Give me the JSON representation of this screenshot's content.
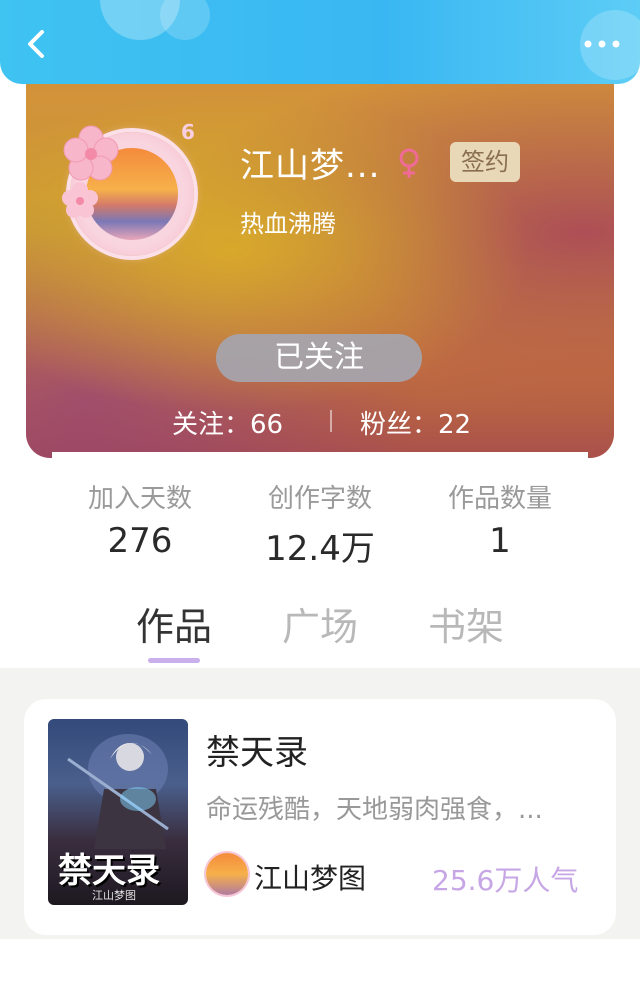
{
  "header": {
    "back_icon": "chevron-left-icon",
    "more_icon": "more-dots-icon"
  },
  "profile": {
    "username": "江山梦...",
    "gender_icon": "female-icon",
    "sign_badge": "签约",
    "tagline": "热血沸腾",
    "level": "6",
    "follow_button": "已关注",
    "following_text": "关注：66",
    "fans_text": "粉丝：22"
  },
  "stats": [
    {
      "label": "加入天数",
      "value": "276"
    },
    {
      "label": "创作字数",
      "value": "12.4万"
    },
    {
      "label": "作品数量",
      "value": "1"
    }
  ],
  "tabs": [
    {
      "label": "作品",
      "active": true
    },
    {
      "label": "广场",
      "active": false
    },
    {
      "label": "书架",
      "active": false
    }
  ],
  "book": {
    "title": "禁天录",
    "description": "命运残酷，天地弱肉强食，...",
    "author": "江山梦图",
    "popularity": "25.6万人气",
    "cover_title": "禁天录",
    "cover_author": "江山梦图"
  },
  "colors": {
    "header": "#39b7f2",
    "accent_purple": "#c7a6e6",
    "tab_active": "#333333",
    "tab_inactive": "#b8b8b8"
  }
}
